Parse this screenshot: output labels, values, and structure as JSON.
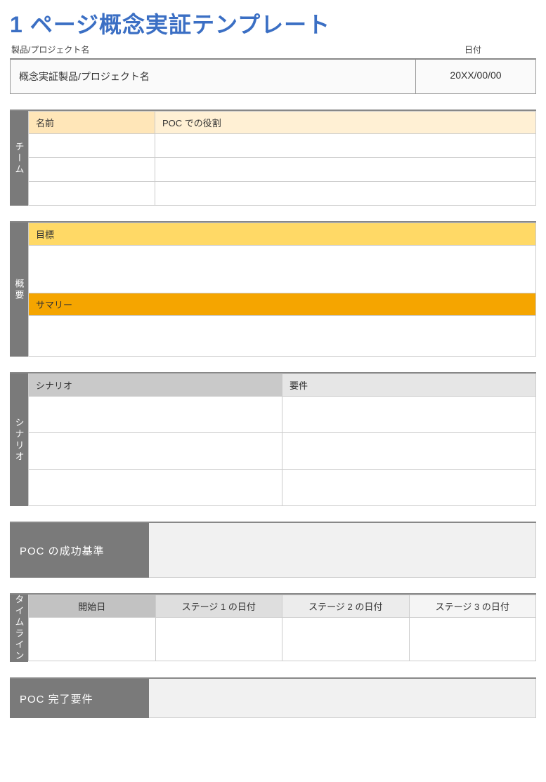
{
  "title": "1 ページ概念実証テンプレート",
  "header": {
    "label_product": "製品/プロジェクト名",
    "label_date": "日付",
    "product_value": "概念実証製品/プロジェクト名",
    "date_value": "20XX/00/00"
  },
  "team": {
    "tab": "チーム",
    "col_name": "名前",
    "col_role": "POC での役割",
    "rows": [
      {
        "name": "",
        "role": ""
      },
      {
        "name": "",
        "role": ""
      },
      {
        "name": "",
        "role": ""
      }
    ]
  },
  "overview": {
    "tab": "概要",
    "goal_header": "目標",
    "goal_body": "",
    "summary_header": "サマリー",
    "summary_body": ""
  },
  "scenario": {
    "tab": "シナリオ",
    "col_scenario": "シナリオ",
    "col_req": "要件",
    "rows": [
      {
        "scenario": "",
        "req": ""
      },
      {
        "scenario": "",
        "req": ""
      },
      {
        "scenario": "",
        "req": ""
      }
    ]
  },
  "success": {
    "label": "POC の成功基準",
    "body": ""
  },
  "timeline": {
    "tab": "タイムライン",
    "col_start": "開始日",
    "col_s1": "ステージ 1 の日付",
    "col_s2": "ステージ 2 の日付",
    "col_s3": "ステージ 3 の日付",
    "row": {
      "start": "",
      "s1": "",
      "s2": "",
      "s3": ""
    }
  },
  "completion": {
    "label": "POC 完了要件",
    "body": ""
  }
}
